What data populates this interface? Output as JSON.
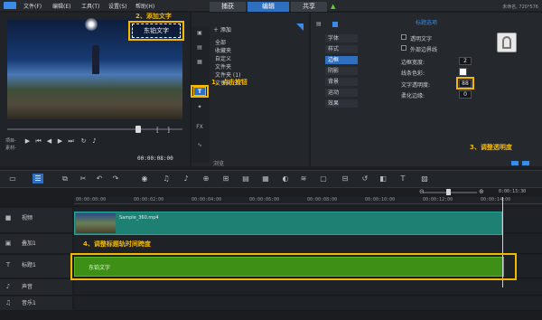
{
  "menu": {
    "file": "文件(F)",
    "edit": "编辑(E)",
    "tools": "工具(T)",
    "settings": "设置(S)",
    "help": "帮助(H)"
  },
  "tabs": [
    {
      "label": "捕获"
    },
    {
      "label": "编辑"
    },
    {
      "label": "共享"
    }
  ],
  "resolution": "未命名, 720*576",
  "preview": {
    "overlay_text": "东铂文字",
    "timecode": "00:00:08:00",
    "mode_labels": [
      "项目-",
      "素材-"
    ]
  },
  "library": {
    "add_label": "添加",
    "items": [
      "全部",
      "收藏夹",
      "自定义",
      "文件夹",
      "文件夹 (1)",
      "文件夹 (2)"
    ],
    "browse_label": "浏览",
    "tools": [
      "▣",
      "▤",
      "▦",
      "T",
      "✦",
      "FX",
      "∿"
    ]
  },
  "options": {
    "title": "标题选项",
    "tabs": [
      {
        "label": "字体"
      },
      {
        "label": "样式"
      },
      {
        "label": "边框"
      },
      {
        "label": "阴影"
      },
      {
        "label": "背景"
      },
      {
        "label": "运动"
      },
      {
        "label": "效果"
      }
    ],
    "transparent_text": "透明文字",
    "outer_border": "外部边界线",
    "border_width_label": "边框宽度:",
    "border_width_value": "2",
    "line_color_label": "线条色彩:",
    "text_transparency_label": "文字透明度:",
    "text_transparency_value": "88",
    "soft_edge_label": "柔化边缘:",
    "soft_edge_value": "0"
  },
  "timeline": {
    "ruler_ticks": [
      "00:00:00:00",
      "00:00:02:00",
      "00:00:04:00",
      "00:00:06:00",
      "00:00:08:00",
      "00:00:10:00",
      "00:00:12:00",
      "00:00:14:00"
    ],
    "zoom_time": "0:00:13:30",
    "tracks": [
      {
        "label": "视频"
      },
      {
        "label": "叠加1"
      },
      {
        "label": "标题1"
      },
      {
        "label": "声音"
      },
      {
        "label": "音乐1"
      }
    ],
    "video_clip_name": "Sample_360.mp4",
    "title_clip_name": "东铂文字"
  },
  "annotations": {
    "step1": "1、点击按钮",
    "step2": "2、添加文字",
    "step3": "3、调整透明度",
    "step4": "4、调整标题轨时间跨度"
  },
  "colors": {
    "accent": "#2f6fc0",
    "annotation": "#f5b800",
    "video_clip": "#1e7f73",
    "title_clip": "#3d8f16"
  }
}
